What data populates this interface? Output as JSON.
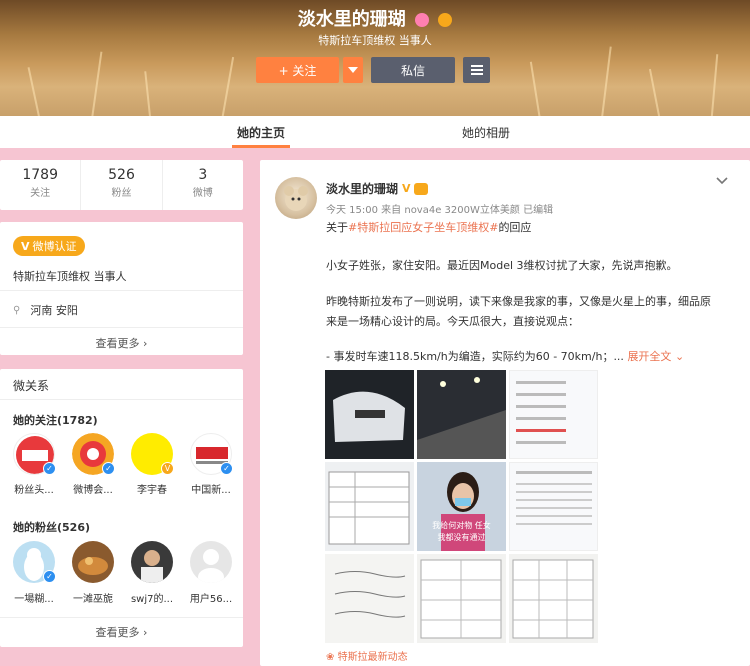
{
  "profile": {
    "name": "淡水里的珊瑚",
    "subtitle": "特斯拉车顶维权 当事人",
    "follow_label": "+ 关注",
    "message_label": "私信"
  },
  "tabs": {
    "home": "她的主页",
    "album": "她的相册"
  },
  "stats": [
    {
      "num": "1789",
      "label": "关注"
    },
    {
      "num": "526",
      "label": "粉丝"
    },
    {
      "num": "3",
      "label": "微博"
    }
  ],
  "info": {
    "verify_badge": "微博认证",
    "description": "特斯拉车顶维权 当事人",
    "location": "河南 安阳",
    "see_more": "查看更多"
  },
  "relations": {
    "title": "微关系",
    "following_title": "她的关注(1782)",
    "following": [
      "粉丝头...",
      "微博会...",
      "李宇春",
      "中国新..."
    ],
    "fans_title": "她的粉丝(526)",
    "fans": [
      "一場糊...",
      "一滩巫旎",
      "swj7的...",
      "用户56..."
    ],
    "see_more": "查看更多"
  },
  "post": {
    "author": "淡水里的珊瑚",
    "meta": "今天 15:00 来自 nova4e 3200W立体美颜  已编辑",
    "line1_pre": "关于",
    "line1_hash": "#特斯拉回应女子坐车顶维权#",
    "line1_post": "的回应",
    "line2": "小女子姓张，家住安阳。最近因Model 3维权讨扰了大家，先说声抱歉。",
    "line3": "昨晚特斯拉发布了一则说明，读下来像是我家的事，又像是火星上的事，细品原",
    "line4": "来是一场精心设计的局。今天瓜很大，直接说观点：",
    "line5": "-  事发时车速118.5km/h为编造，实际约为60 - 70km/h；...",
    "expand": "展开全文",
    "footer_tag": "特斯拉最新动态",
    "img_caption_1": "我给何对物 任女",
    "img_caption_2": "我都没有通过"
  }
}
